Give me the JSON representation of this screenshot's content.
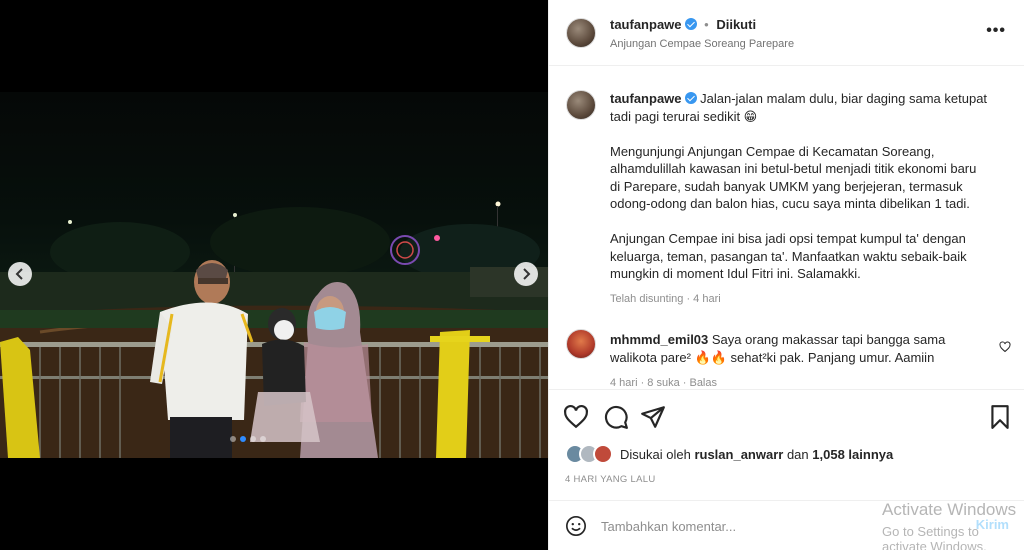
{
  "post": {
    "username": "taufanpawe",
    "separator": "•",
    "follow_status": "Diikuti",
    "location": "Anjungan Cempae Soreang Parepare",
    "more_label": "•••"
  },
  "caption": {
    "username": "taufanpawe",
    "line1": "Jalan-jalan malam dulu, biar daging sama ketupat tadi pagi terurai sedikit 😁",
    "para2": "Mengunjungi Anjungan Cempae di Kecamatan Soreang, alhamdulillah kawasan ini betul-betul menjadi titik ekonomi baru di Parepare, sudah banyak UMKM yang berjejeran, termasuk odong-odong dan balon hias, cucu saya minta dibelikan 1 tadi.",
    "para3": "Anjungan Cempae ini bisa jadi opsi tempat kumpul ta' dengan keluarga, teman, pasangan ta'. Manfaatkan waktu sebaik-baik mungkin di moment Idul Fitri ini. Salamakki.",
    "edited": "Telah disunting · 4 hari"
  },
  "comment": {
    "username": "mhmmd_emil03",
    "text": "Saya orang makassar tapi bangga sama walikota pare² 🔥🔥 sehat²ki pak. Panjang umur. Aamiin",
    "meta": "4 hari · 8 suka · Balas"
  },
  "likes": {
    "prefix": "Disukai oleh",
    "user": "ruslan_anwarr",
    "conj": "dan",
    "count": "1,058 lainnya"
  },
  "timestamp": "4 HARI YANG LALU",
  "add_comment": {
    "placeholder": "Tambahkan komentar...",
    "send": "Kirim"
  },
  "carousel": {
    "slide_count": 4,
    "active_slide": 1
  },
  "watermark": {
    "line1": "Activate Windows",
    "line2": "Go to Settings to activate Windows."
  },
  "colors": {
    "verified": "#3897f0",
    "link_blue": "#0095f6",
    "active_dot": "#2f8cff"
  }
}
